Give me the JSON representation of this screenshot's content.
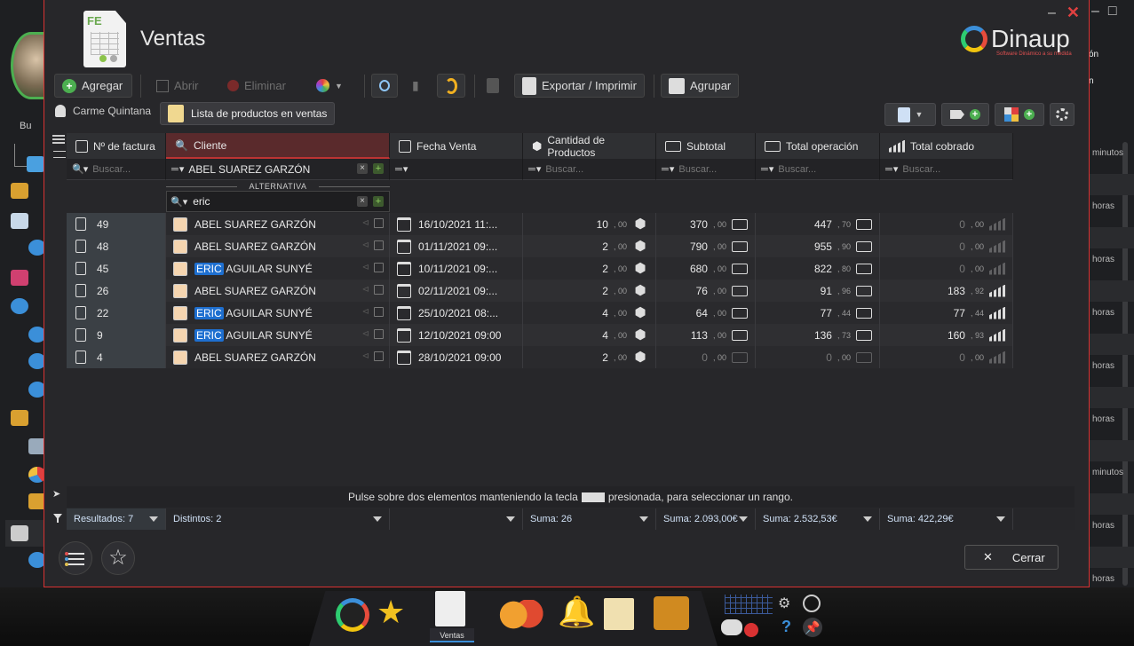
{
  "window": {
    "title": "Ventas",
    "brand": "Dinaup",
    "brand_tagline": "Software Dinámico a su medida"
  },
  "toolbar": {
    "add_label": "Agregar",
    "open_label": "Abrir",
    "delete_label": "Eliminar",
    "export_label": "Exportar / Imprimir",
    "group_label": "Agrupar"
  },
  "context": {
    "user": "Carme Quintana",
    "list_label": "Lista de productos en ventas"
  },
  "columns": [
    {
      "label": "Nº de factura",
      "icon": "invoice-icon"
    },
    {
      "label": "Cliente",
      "icon": "search-person-icon"
    },
    {
      "label": "Fecha Venta",
      "icon": "calendar-icon"
    },
    {
      "label": "Cantidad de Productos",
      "icon": "cubes-icon"
    },
    {
      "label": "Subtotal",
      "icon": "cash-icon"
    },
    {
      "label": "Total operación",
      "icon": "cash-icon"
    },
    {
      "label": "Total cobrado",
      "icon": "bars-icon"
    }
  ],
  "filters": {
    "search_placeholder": "Buscar...",
    "cliente_value": "ABEL SUAREZ GARZÓN",
    "alt_label": "ALTERNATIVA",
    "alt_value": "eric"
  },
  "rows": [
    {
      "num": "49",
      "hl": "",
      "client": "ABEL SUAREZ GARZÓN",
      "date": "16/10/2021 11:...",
      "qty": "10",
      "qty_dec": "00",
      "sub": "370",
      "sub_dec": "00",
      "tot": "447",
      "tot_dec": "70",
      "paid": "0",
      "paid_dec": "00",
      "paid_zero": true,
      "sub_zero": false
    },
    {
      "num": "48",
      "hl": "",
      "client": "ABEL SUAREZ GARZÓN",
      "date": "01/11/2021 09:...",
      "qty": "2",
      "qty_dec": "00",
      "sub": "790",
      "sub_dec": "00",
      "tot": "955",
      "tot_dec": "90",
      "paid": "0",
      "paid_dec": "00",
      "paid_zero": true,
      "sub_zero": false
    },
    {
      "num": "45",
      "hl": "ERIC",
      "client": " AGUILAR SUNYÉ",
      "date": "10/11/2021 09:...",
      "qty": "2",
      "qty_dec": "00",
      "sub": "680",
      "sub_dec": "00",
      "tot": "822",
      "tot_dec": "80",
      "paid": "0",
      "paid_dec": "00",
      "paid_zero": true,
      "sub_zero": false
    },
    {
      "num": "26",
      "hl": "",
      "client": "ABEL SUAREZ GARZÓN",
      "date": "02/11/2021 09:...",
      "qty": "2",
      "qty_dec": "00",
      "sub": "76",
      "sub_dec": "00",
      "tot": "91",
      "tot_dec": "96",
      "paid": "183",
      "paid_dec": "92",
      "paid_zero": false,
      "sub_zero": false
    },
    {
      "num": "22",
      "hl": "ERIC",
      "client": " AGUILAR SUNYÉ",
      "date": "25/10/2021 08:...",
      "qty": "4",
      "qty_dec": "00",
      "sub": "64",
      "sub_dec": "00",
      "tot": "77",
      "tot_dec": "44",
      "paid": "77",
      "paid_dec": "44",
      "paid_zero": false,
      "sub_zero": false
    },
    {
      "num": "9",
      "hl": "ERIC",
      "client": " AGUILAR SUNYÉ",
      "date": "12/10/2021 09:00",
      "qty": "4",
      "qty_dec": "00",
      "sub": "113",
      "sub_dec": "00",
      "tot": "136",
      "tot_dec": "73",
      "paid": "160",
      "paid_dec": "93",
      "paid_zero": false,
      "sub_zero": false
    },
    {
      "num": "4",
      "hl": "",
      "client": "ABEL SUAREZ GARZÓN",
      "date": "28/10/2021 09:00",
      "qty": "2",
      "qty_dec": "00",
      "sub": "0",
      "sub_dec": "00",
      "tot": "0",
      "tot_dec": "00",
      "paid": "0",
      "paid_dec": "00",
      "paid_zero": true,
      "sub_zero": true
    }
  ],
  "hint": {
    "before": "Pulse sobre dos elementos manteniendo la tecla",
    "after": "presionada, para seleccionar un rango."
  },
  "summary": {
    "results": "Resultados: 7",
    "distinct": "Distintos: 2",
    "sum_qty": "Suma: 26",
    "sum_sub": "Suma: 2.093,00€",
    "sum_tot": "Suma: 2.532,53€",
    "sum_paid": "Suma: 422,29€"
  },
  "footer": {
    "close_label": "Cerrar"
  },
  "taskbar": {
    "active_label": "Ventas"
  },
  "background": {
    "left_search": "Bu",
    "right_times": [
      "minutos",
      "horas",
      "horas",
      "horas",
      "horas",
      "horas",
      "horas",
      "minutos",
      "horas",
      "horas"
    ],
    "right_top": [
      "ón",
      "n"
    ]
  }
}
